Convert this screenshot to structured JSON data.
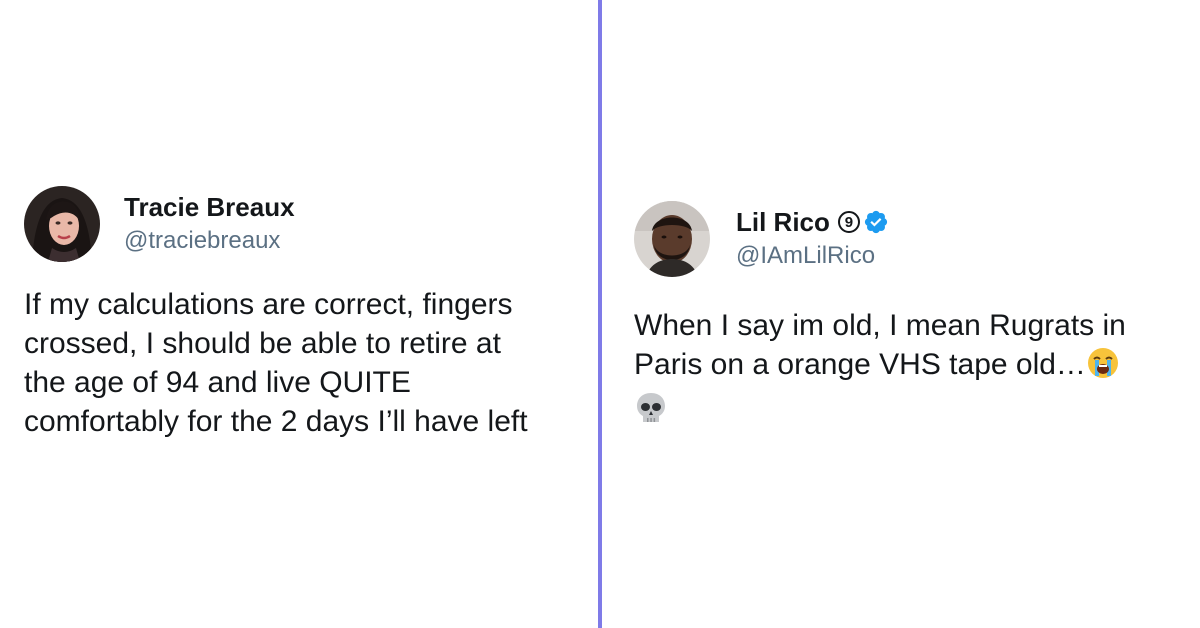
{
  "tweets": [
    {
      "display_name": "Tracie Breaux",
      "handle": "@traciebreaux",
      "text": "If my calculations are correct, fingers\ncrossed, I should be able to retire at\nthe age of 94 and live QUITE\ncomfortably for the 2 days I’ll have left",
      "avatar_icon": "woman-avatar"
    },
    {
      "display_name": "Lil Rico",
      "badge_text": "9",
      "verified": true,
      "verified_color": "#1d9bf0",
      "handle": "@IAmLilRico",
      "text": "When I say im old, I mean Rugrats in Paris on a orange VHS tape old…",
      "emojis": [
        "loudly-crying-face-icon",
        "skull-icon"
      ],
      "avatar_icon": "man-avatar"
    }
  ],
  "colors": {
    "divider": "#7f7be8",
    "text": "#14171a",
    "handle": "#5b7083"
  }
}
